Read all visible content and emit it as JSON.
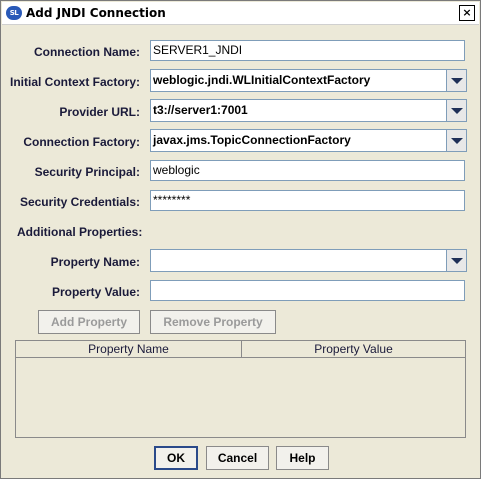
{
  "window": {
    "icon_text": "SL",
    "title": "Add JNDI Connection",
    "close_glyph": "×"
  },
  "form": {
    "connection_name": {
      "label": "Connection Name:",
      "value": "SERVER1_JNDI"
    },
    "initial_context_factory": {
      "label": "Initial Context Factory:",
      "value": "weblogic.jndi.WLInitialContextFactory"
    },
    "provider_url": {
      "label": "Provider URL:",
      "value": "t3://server1:7001"
    },
    "connection_factory": {
      "label": "Connection Factory:",
      "value": "javax.jms.TopicConnectionFactory"
    },
    "security_principal": {
      "label": "Security Principal:",
      "value": "weblogic"
    },
    "security_credentials": {
      "label": "Security Credentials:",
      "value": "********"
    },
    "additional_properties_label": "Additional Properties:",
    "property_name": {
      "label": "Property Name:",
      "value": ""
    },
    "property_value": {
      "label": "Property Value:",
      "value": ""
    }
  },
  "property_buttons": {
    "add": "Add Property",
    "remove": "Remove Property"
  },
  "table": {
    "columns": [
      "Property Name",
      "Property Value"
    ],
    "rows": []
  },
  "footer": {
    "ok": "OK",
    "cancel": "Cancel",
    "help": "Help"
  }
}
